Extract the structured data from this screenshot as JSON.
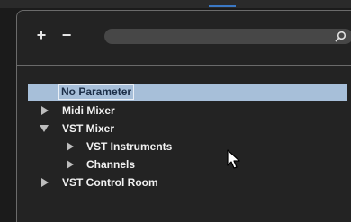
{
  "toolbar": {
    "add_label": "+",
    "remove_label": "−",
    "search_value": "",
    "search_placeholder": ""
  },
  "tree": {
    "items": [
      {
        "label": "No Parameter",
        "selected": true,
        "expandable": false,
        "expanded": false
      },
      {
        "label": "Midi Mixer",
        "selected": false,
        "expandable": true,
        "expanded": false
      },
      {
        "label": "VST Mixer",
        "selected": false,
        "expandable": true,
        "expanded": true
      },
      {
        "label": "VST Instruments",
        "selected": false,
        "expandable": true,
        "expanded": false
      },
      {
        "label": "Channels",
        "selected": false,
        "expandable": true,
        "expanded": false
      },
      {
        "label": "VST Control Room",
        "selected": false,
        "expandable": true,
        "expanded": false
      }
    ]
  },
  "colors": {
    "background": "#232323",
    "selection": "#a7bfd9",
    "search_field": "#474747",
    "text": "#f2f2f2"
  }
}
